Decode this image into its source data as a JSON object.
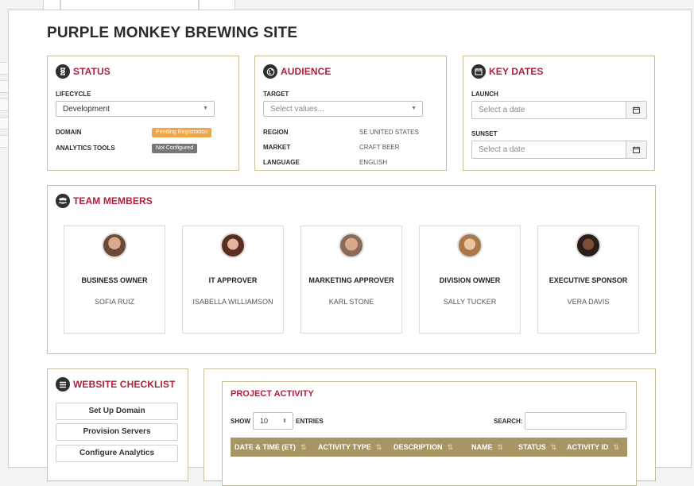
{
  "page": {
    "title": "PURPLE MONKEY BREWING SITE"
  },
  "status": {
    "title": "STATUS",
    "icon": "hourglass-icon",
    "lifecycle_label": "LIFECYCLE",
    "lifecycle_value": "Development",
    "domain_label": "DOMAIN",
    "domain_badge": "Pending Registration",
    "analytics_label": "ANALYTICS TOOLS",
    "analytics_badge": "Not Configured",
    "colors": {
      "pending": "#f0a64a",
      "not_configured": "#777777"
    }
  },
  "audience": {
    "title": "AUDIENCE",
    "icon": "globe-icon",
    "target_label": "TARGET",
    "target_placeholder": "Select values...",
    "region_label": "REGION",
    "region_value": "SE UNITED STATES",
    "market_label": "MARKET",
    "market_value": "CRAFT BEER",
    "language_label": "LANGUAGE",
    "language_value": "ENGLISH"
  },
  "key_dates": {
    "title": "KEY DATES",
    "icon": "calendar-icon",
    "launch_label": "LAUNCH",
    "launch_placeholder": "Select a date",
    "sunset_label": "SUNSET",
    "sunset_placeholder": "Select a date"
  },
  "team": {
    "title": "TEAM MEMBERS",
    "icon": "team-icon",
    "members": [
      {
        "role": "BUSINESS OWNER",
        "name": "SOFIA RUIZ"
      },
      {
        "role": "IT APPROVER",
        "name": "ISABELLA WILLIAMSON"
      },
      {
        "role": "MARKETING APPROVER",
        "name": "KARL STONE"
      },
      {
        "role": "DIVISION OWNER",
        "name": "SALLY TUCKER"
      },
      {
        "role": "EXECUTIVE SPONSOR",
        "name": "VERA DAVIS"
      }
    ]
  },
  "checklist": {
    "title": "WEBSITE CHECKLIST",
    "icon": "list-icon",
    "items": [
      "Set Up Domain",
      "Provision Servers",
      "Configure Analytics"
    ]
  },
  "activity": {
    "title": "PROJECT ACTIVITY",
    "show_label": "SHOW",
    "entries_value": "10",
    "entries_label": "ENTRIES",
    "search_label": "SEARCH:",
    "columns": [
      "DATE & TIME (ET)",
      "ACTIVITY TYPE",
      "DESCRIPTION",
      "NAME",
      "STATUS",
      "ACTIVITY ID"
    ],
    "header_color": "#a89564"
  },
  "colors": {
    "accent": "#b01f3c",
    "panel_border": "#c9bf9a"
  }
}
